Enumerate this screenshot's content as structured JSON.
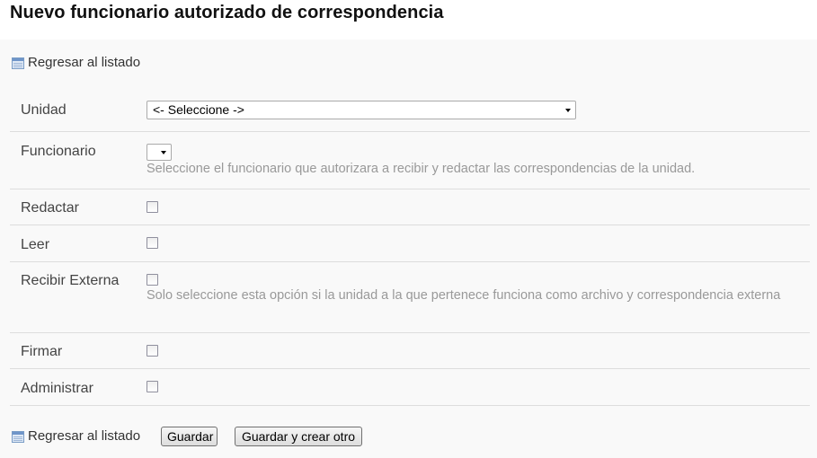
{
  "page": {
    "title": "Nuevo funcionario autorizado de correspondencia"
  },
  "nav": {
    "back_top_label": "Regresar al listado",
    "back_bottom_label": "Regresar al listado",
    "back_icon": "list-icon"
  },
  "form": {
    "unidad": {
      "label": "Unidad",
      "selected": "<- Seleccione ->"
    },
    "funcionario": {
      "label": "Funcionario",
      "selected": "",
      "help": "Seleccione el funcionario que autorizara a recibir y redactar las correspondencias de la unidad."
    },
    "redactar": {
      "label": "Redactar",
      "checked": false
    },
    "leer": {
      "label": "Leer",
      "checked": false
    },
    "recibir_externa": {
      "label": "Recibir Externa",
      "checked": false,
      "help": "Solo seleccione esta opción si la unidad a la que pertenece funciona como archivo y correspondencia externa"
    },
    "firmar": {
      "label": "Firmar",
      "checked": false
    },
    "administrar": {
      "label": "Administrar",
      "checked": false
    }
  },
  "actions": {
    "save_label": "Guardar",
    "save_and_new_label": "Guardar y crear otro"
  }
}
